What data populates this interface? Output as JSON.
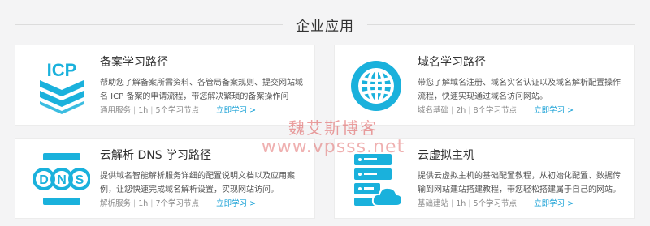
{
  "section": {
    "title": "企业应用"
  },
  "cards": [
    {
      "title": "备案学习路径",
      "icon": "icp-icon",
      "desc": "帮助您了解备案所需资料、各管局备案规则、提交网站域名 ICP 备案的申请流程，带您解决繁琐的备案操作问题。",
      "category": "通用服务",
      "duration": "1h",
      "nodes": "5个学习节点",
      "link": "立即学习 >"
    },
    {
      "title": "域名学习路径",
      "icon": "globe-icon",
      "desc": "带您了解域名注册、域名实名认证以及域名解析配置操作流程，快速实现通过域名访问网站。",
      "category": "域名基础",
      "duration": "2h",
      "nodes": "8个学习节点",
      "link": "立即学习 >"
    },
    {
      "title": "云解析 DNS 学习路径",
      "icon": "dns-icon",
      "desc": "提供域名智能解析服务详细的配置说明文档以及应用案例，让您快速完成域名解析设置，实现网站访问。",
      "category": "解析服务",
      "duration": "1h",
      "nodes": "7个学习节点",
      "link": "立即学习 >"
    },
    {
      "title": "云虚拟主机",
      "icon": "server-cloud-icon",
      "desc": "提供云虚拟主机的基础配置教程，从初始化配置、数据传输到网站建站搭建教程，带您轻松搭建属于自己的网站。",
      "category": "基础建站",
      "duration": "1h",
      "nodes": "5个学习节点",
      "link": "立即学习 >"
    }
  ],
  "watermark": {
    "line1": "魏艾斯博客",
    "line2": "www.vpsss.net"
  },
  "colors": {
    "accent": "#1ab1dc",
    "link": "#1aa1d6"
  }
}
